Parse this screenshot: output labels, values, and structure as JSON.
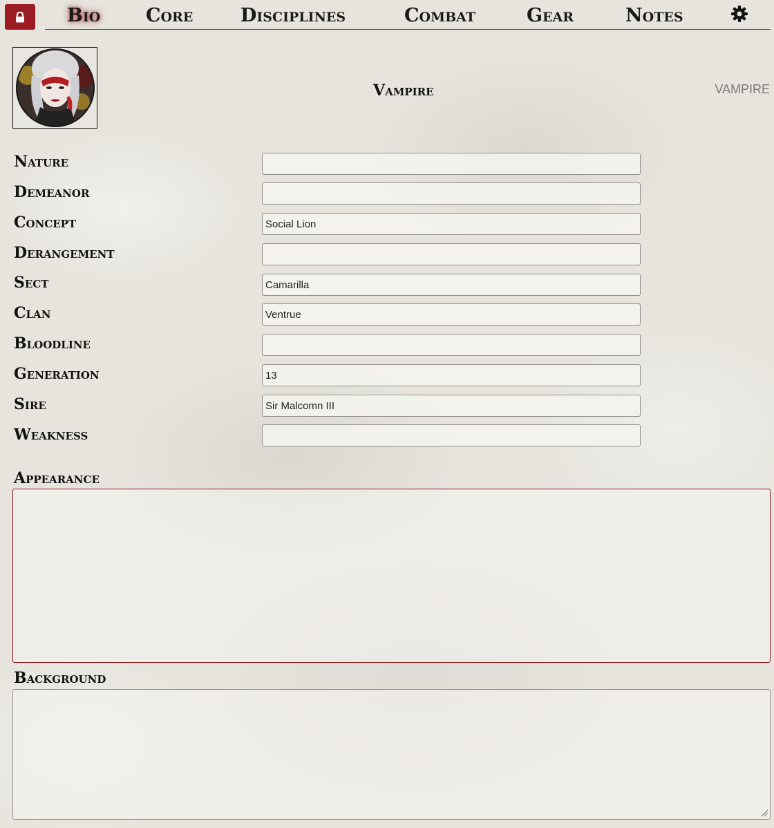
{
  "nav": {
    "lock_icon": "lock-icon",
    "tabs": [
      {
        "label": "Bio",
        "active": true
      },
      {
        "label": "Core",
        "active": false
      },
      {
        "label": "Disciplines",
        "active": false
      },
      {
        "label": "Combat",
        "active": false
      },
      {
        "label": "Gear",
        "active": false
      },
      {
        "label": "Notes",
        "active": false
      }
    ],
    "settings_icon": "gear-icon"
  },
  "header": {
    "sheet_type": "Vampire",
    "sheet_type_right": "VAMPIRE"
  },
  "fields": [
    {
      "label": "Nature",
      "value": ""
    },
    {
      "label": "Demeanor",
      "value": ""
    },
    {
      "label": "Concept",
      "value": "Social Lion"
    },
    {
      "label": "Derangement",
      "value": ""
    },
    {
      "label": "Sect",
      "value": "Camarilla"
    },
    {
      "label": "Clan",
      "value": "Ventrue"
    },
    {
      "label": "Bloodline",
      "value": ""
    },
    {
      "label": "Generation",
      "value": "13"
    },
    {
      "label": "Sire",
      "value": "Sir Malcomn III"
    },
    {
      "label": "Weakness",
      "value": ""
    }
  ],
  "appearance": {
    "label": "Appearance",
    "value": ""
  },
  "background": {
    "label": "Background",
    "value": ""
  },
  "colors": {
    "accent": "#9b1c22",
    "divider": "#8b2a2a",
    "parchment": "#e6e4dd"
  }
}
